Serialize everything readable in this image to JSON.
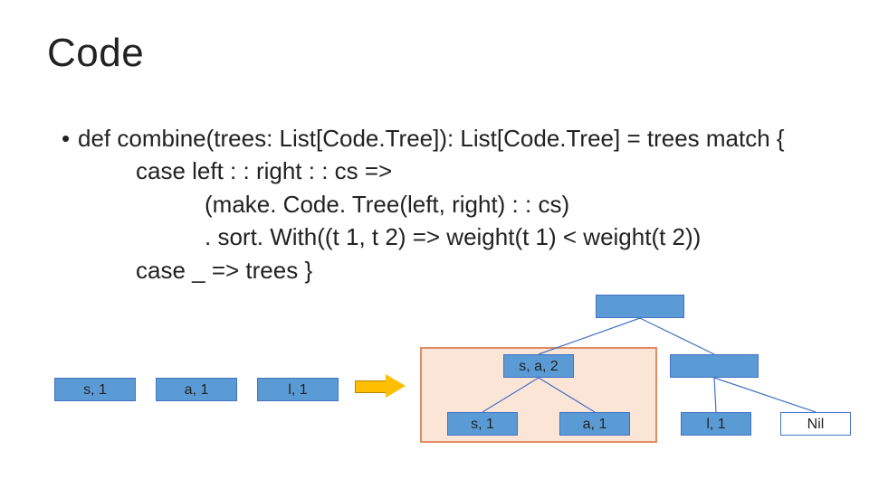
{
  "title": "Code",
  "code": {
    "l1": "def combine(trees: List[Code.Tree]): List[Code.Tree] = trees match {",
    "l2": "case left : : right : : cs =>",
    "l3": "(make. Code. Tree(left, right) : : cs)",
    "l4": ". sort. With((t 1, t 2) => weight(t 1) < weight(t 2))",
    "l5": "case _ => trees   }"
  },
  "left_row": {
    "n1": "s, 1",
    "n2": "a, 1",
    "n3": "l, 1"
  },
  "tree": {
    "root_hidden": "",
    "sa2": "s, a, 2",
    "s1": "s, 1",
    "a1": "a, 1",
    "l1": "l, 1",
    "nil": "Nil"
  }
}
